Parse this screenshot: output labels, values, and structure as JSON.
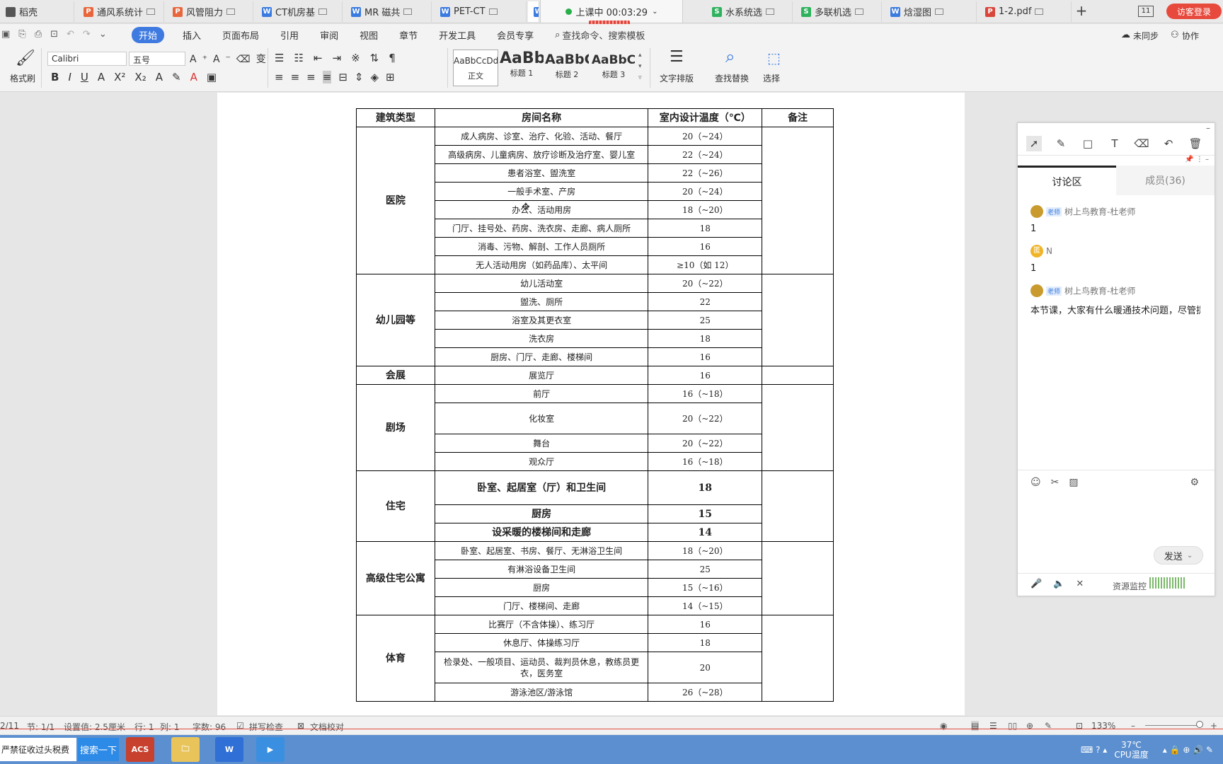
{
  "tabs": [
    {
      "label": "稻壳",
      "icon": "daoke-icon"
    },
    {
      "label": "通风系统计",
      "icon": "ppt-icon"
    },
    {
      "label": "风管阻力",
      "icon": "ppt-icon"
    },
    {
      "label": "CT机房基",
      "icon": "word-icon"
    },
    {
      "label": "MR 磁共",
      "icon": "word-icon"
    },
    {
      "label": "PET-CT",
      "icon": "word-icon"
    },
    {
      "label": "水系统选",
      "icon": "sheet-icon"
    },
    {
      "label": "多联机选",
      "icon": "sheet-icon"
    },
    {
      "label": "焓湿图",
      "icon": "word-icon"
    },
    {
      "label": "1-2.pdf",
      "icon": "pdf-icon"
    }
  ],
  "class_status": {
    "label": "上课中 00:03:29"
  },
  "tabbar": {
    "new_tab": "+",
    "badge": "11",
    "login": "访客登录"
  },
  "menu": {
    "items": [
      "开始",
      "插入",
      "页面布局",
      "引用",
      "审阅",
      "视图",
      "章节",
      "开发工具",
      "会员专享"
    ],
    "search": "查找命令、搜索模板",
    "sync": "未同步",
    "collab": "协作"
  },
  "ribbon": {
    "format_painter": "格式刷",
    "font": "Calibri",
    "size": "五号",
    "styles": [
      {
        "preview": "AaBbCcDd",
        "name": "正文"
      },
      {
        "preview": "AaBb",
        "name": "标题 1"
      },
      {
        "preview": "AaBbC",
        "name": "标题 2"
      },
      {
        "preview": "AaBbC",
        "name": "标题 3"
      }
    ],
    "text_layout": "文字排版",
    "find_replace": "查找替换",
    "select": "选择"
  },
  "doc_table": {
    "headers": [
      "建筑类型",
      "房间名称",
      "室内设计温度（℃）",
      "备注"
    ],
    "groups": [
      {
        "category": "医院",
        "rows": [
          [
            "成人病房、诊室、治疗、化验、活动、餐厅",
            "20（~24）"
          ],
          [
            "高级病房、儿童病房、放疗诊断及治疗室、婴儿室",
            "22（~24）"
          ],
          [
            "患者浴室、盥洗室",
            "22（~26）"
          ],
          [
            "一般手术室、产房",
            "20（~24）"
          ],
          [
            "办公、活动用房",
            "18（~20）"
          ],
          [
            "门厅、挂号处、药房、洗衣房、走廊、病人厕所",
            "18"
          ],
          [
            "消毒、污物、解剖、工作人员厕所",
            "16"
          ],
          [
            "无人活动用房（如药品库）、太平间",
            "≥10（如 12）"
          ]
        ]
      },
      {
        "category": "幼儿园等",
        "rows": [
          [
            "幼儿活动室",
            "20（~22）"
          ],
          [
            "盥洗、厕所",
            "22"
          ],
          [
            "浴室及其更衣室",
            "25"
          ],
          [
            "洗衣房",
            "18"
          ],
          [
            "厨房、门厅、走廊、楼梯间",
            "16"
          ]
        ]
      },
      {
        "category": "会展",
        "rows": [
          [
            "展览厅",
            "16"
          ]
        ]
      },
      {
        "category": "剧场",
        "rows": [
          [
            "前厅",
            "16（~18）"
          ],
          [
            "化妆室",
            "20（~22）"
          ],
          [
            "舞台",
            "20（~22）"
          ],
          [
            "观众厅",
            "16（~18）"
          ]
        ]
      },
      {
        "category": "住宅",
        "rows": [
          [
            "卧室、起居室（厅）和卫生间",
            "18"
          ],
          [
            "厨房",
            "15"
          ],
          [
            "设采暖的楼梯间和走廊",
            "14"
          ]
        ]
      },
      {
        "category": "高级住宅公寓",
        "rows": [
          [
            "卧室、起居室、书房、餐厅、无淋浴卫生间",
            "18（~20）"
          ],
          [
            "有淋浴设备卫生间",
            "25"
          ],
          [
            "厨房",
            "15（~16）"
          ],
          [
            "门厅、楼梯间、走廊",
            "14（~15）"
          ]
        ]
      },
      {
        "category": "体育",
        "rows": [
          [
            "比赛厅（不含体操）、练习厅",
            "16"
          ],
          [
            "休息厅、体操练习厅",
            "18"
          ],
          [
            "检录处、一般项目、运动员、裁判员休息，教练员更衣，医务室",
            "20"
          ],
          [
            "游泳池区/游泳馆",
            "26（~28）"
          ]
        ]
      }
    ]
  },
  "panel": {
    "tabs": [
      "讨论区",
      "成员(36)"
    ],
    "messages": [
      {
        "role": "老师",
        "user": "树上鸟教育-杜老师",
        "text": "1"
      },
      {
        "role": "",
        "user": "N",
        "avatar_char": "匿",
        "text": "1"
      },
      {
        "role": "老师",
        "user": "树上鸟教育-杜老师",
        "text": "本节课，大家有什么暖通技术问题，尽管提"
      }
    ],
    "send": "发送",
    "resource_monitor": "资源监控"
  },
  "status": {
    "page": "2/11",
    "section": "节: 1/1",
    "setting": "设置值: 2.5厘米",
    "row": "行: 1",
    "col": "列: 1",
    "words": "字数: 96",
    "spell": "拼写检查",
    "proof": "文档校对",
    "zoom": "133%"
  },
  "taskbar": {
    "search_text": "严禁征收过头税费",
    "search_button": "搜索一下",
    "apps": [
      "ACS",
      "文件夹",
      "WPS",
      "播放器"
    ],
    "temp": "37℃",
    "cpu": "CPU温度"
  },
  "colors": {
    "accent": "#3f7ae0",
    "login": "#e8493d",
    "taskbar": "#5b8fcf"
  }
}
